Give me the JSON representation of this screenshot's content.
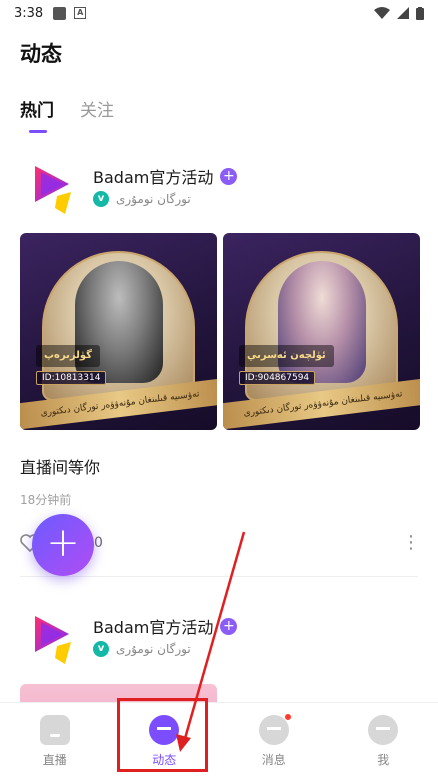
{
  "status_bar": {
    "time": "3:38",
    "notif_letter": "A"
  },
  "header": {
    "title": "动态"
  },
  "tabs": [
    {
      "label": "热门",
      "active": true
    },
    {
      "label": "关注",
      "active": false
    }
  ],
  "posts": [
    {
      "author": "Badam官方活动",
      "subtitle": "تورگان نومۇرى",
      "cards": [
        {
          "name": "گۈلزىرەپ",
          "id": "ID:10813314",
          "ribbon": "تەۋسىيە قىلىنغان مۇنەۋۋەر تورگان دىكتورى"
        },
        {
          "name": "ئۈلچەن ئەسرىي",
          "id": "ID:904867594",
          "ribbon": "تەۋسىيە قىلىنغان مۇنەۋۋەر تورگان دىكتورى"
        }
      ],
      "caption": "直播间等你",
      "time_ago": "18分钟前",
      "comment_count": "0"
    },
    {
      "author": "Badam官方活动",
      "subtitle": "تورگان نومۇرى"
    }
  ],
  "fab": {
    "symbol": "+"
  },
  "bottom_nav": [
    {
      "label": "直播",
      "icon": "live-house-icon",
      "active": false
    },
    {
      "label": "动态",
      "icon": "moments-planet-icon",
      "active": true
    },
    {
      "label": "消息",
      "icon": "message-face-icon",
      "active": false,
      "badge": true
    },
    {
      "label": "我",
      "icon": "profile-face-icon",
      "active": false
    }
  ],
  "colors": {
    "accent": "#7b4dff",
    "highlight": "#e02020",
    "badge": "#ff3b30"
  }
}
